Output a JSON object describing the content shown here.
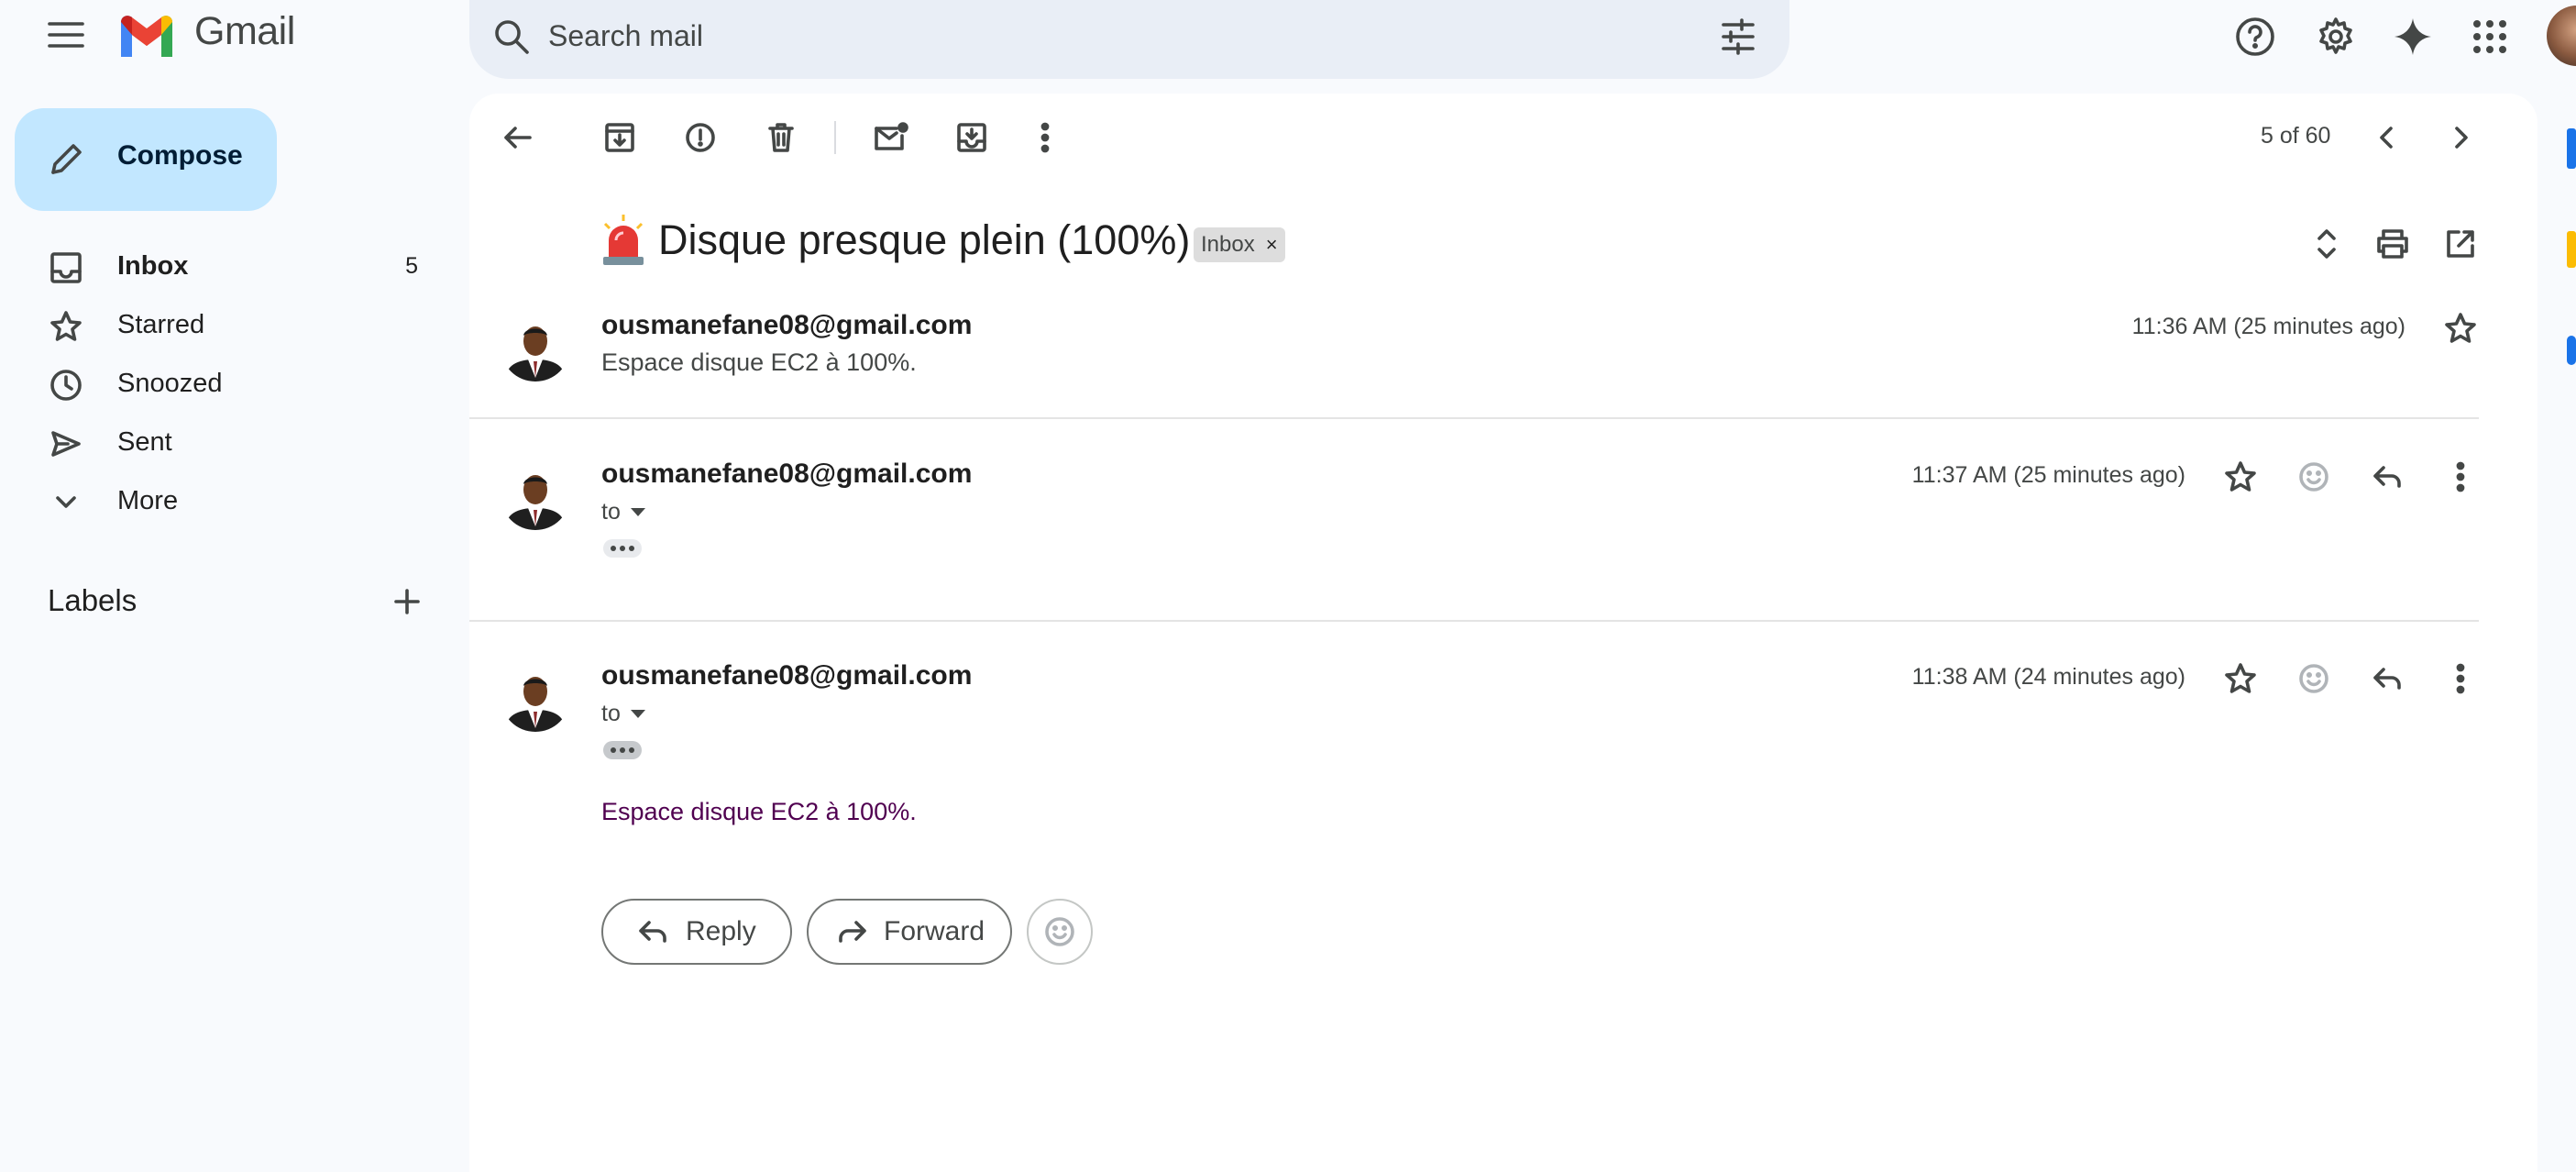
{
  "app": {
    "logo_text": "Gmail"
  },
  "search": {
    "placeholder": "Search mail"
  },
  "sidebar": {
    "compose_label": "Compose",
    "items": [
      {
        "label": "Inbox",
        "count": "5",
        "icon": "inbox-icon"
      },
      {
        "label": "Starred",
        "count": "",
        "icon": "star-icon"
      },
      {
        "label": "Snoozed",
        "count": "",
        "icon": "clock-icon"
      },
      {
        "label": "Sent",
        "count": "",
        "icon": "send-icon"
      },
      {
        "label": "More",
        "count": "",
        "icon": "chevron-down-icon"
      }
    ],
    "labels_title": "Labels"
  },
  "toolbar": {
    "pager": "5 of 60"
  },
  "thread": {
    "subject_emoji": "🚨",
    "subject": "Disque presque plein (100%)",
    "label_chip": "Inbox",
    "label_chip_close": "×",
    "messages": [
      {
        "sender": "ousmanefane08@gmail.com",
        "time": "11:36 AM (25 minutes ago)",
        "snippet": "Espace disque EC2 à 100%."
      },
      {
        "sender": "ousmanefane08@gmail.com",
        "time": "11:37 AM (25 minutes ago)",
        "to": "to"
      },
      {
        "sender": "ousmanefane08@gmail.com",
        "time": "11:38 AM (24 minutes ago)",
        "to": "to",
        "body": "Espace disque EC2 à 100%."
      }
    ]
  },
  "actions": {
    "reply_label": "Reply",
    "forward_label": "Forward"
  },
  "colors": {
    "compose_bg": "#c2e7ff",
    "search_bg": "#e9eef6",
    "page_bg": "#f8fafd",
    "body_text": "#500050"
  }
}
